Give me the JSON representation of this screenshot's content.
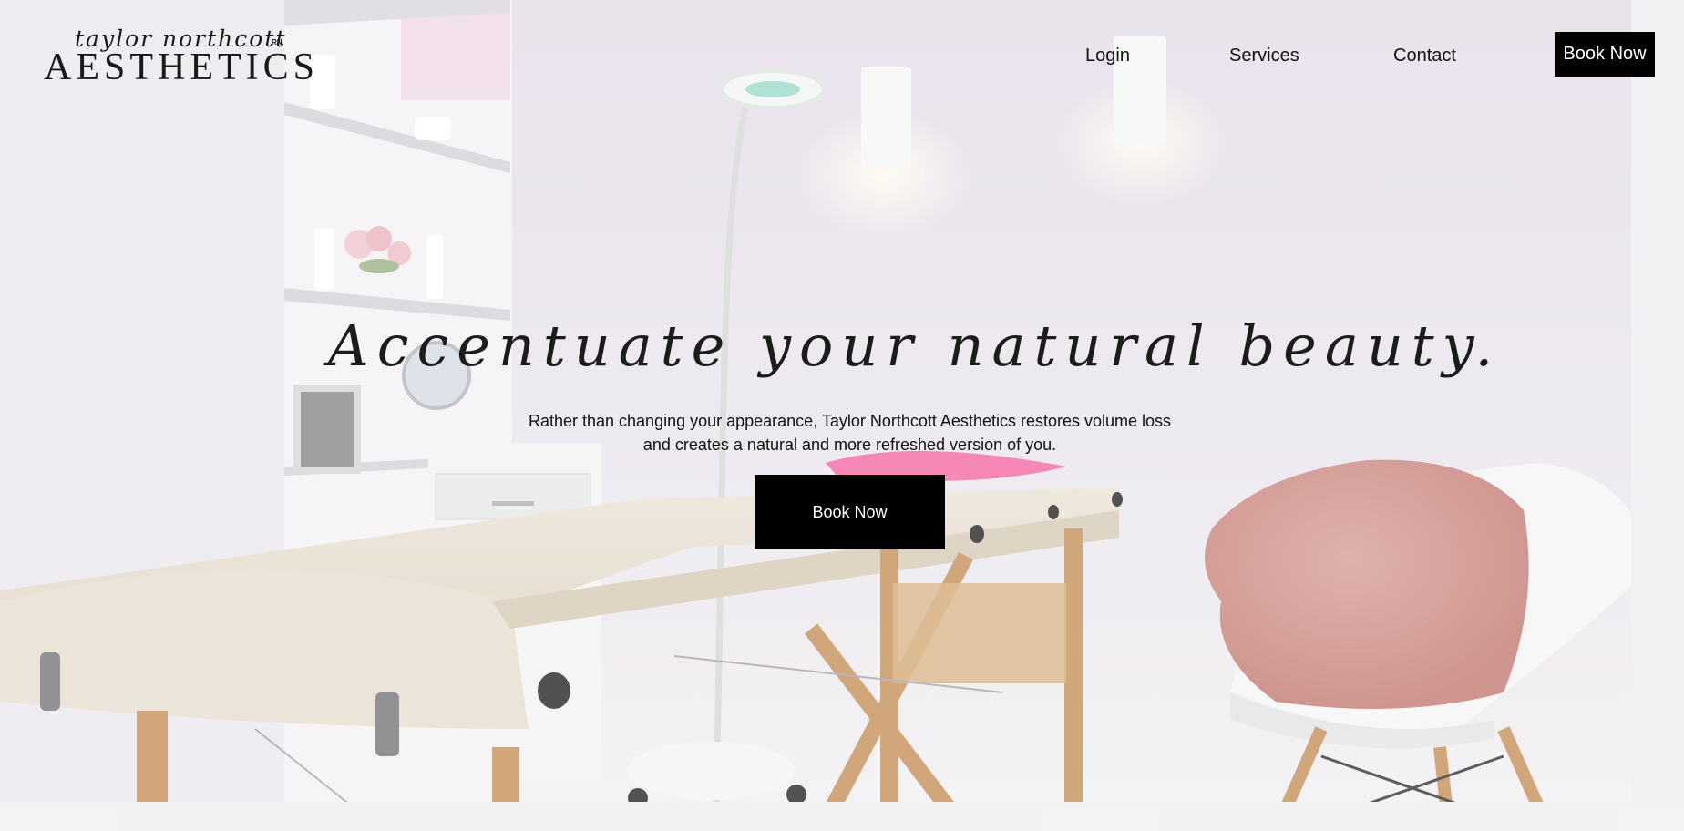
{
  "header": {
    "logo_script": "taylor northcott",
    "logo_suffix": "RN",
    "logo_main": "AESTHETICS",
    "nav": {
      "login": "Login",
      "services": "Services",
      "contact": "Contact"
    },
    "cta_label": "Book Now"
  },
  "hero": {
    "title": "Accentuate your natural beauty.",
    "copy": "Rather than changing your appearance, Taylor Northcott Aesthetics restores volume loss and creates a natural and more refreshed version of you.",
    "cta_label": "Book Now"
  },
  "colors": {
    "button_bg": "#000000",
    "button_text": "#ffffff",
    "text": "#111111"
  }
}
